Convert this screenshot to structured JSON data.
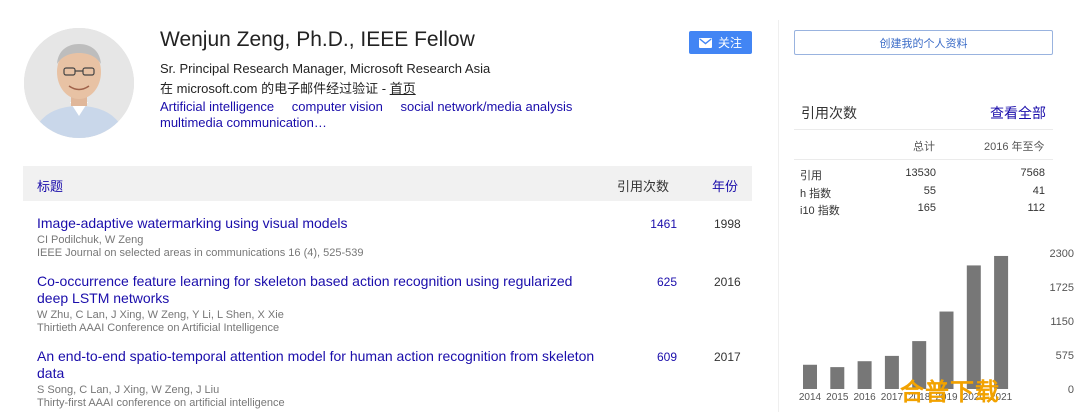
{
  "profile": {
    "name": "Wenjun Zeng, Ph.D., IEEE Fellow",
    "affiliation": "Sr. Principal Research Manager, Microsoft Research Asia",
    "verified_prefix": "在 microsoft.com 的电子邮件经过验证 - ",
    "home_link": "首页",
    "interests": [
      "Artificial intelligence",
      "computer vision",
      "social network/media analysis",
      "multimedia communication…"
    ],
    "follow_label": "关注"
  },
  "table": {
    "headers": {
      "title": "标题",
      "cited_by": "引用次数",
      "year": "年份"
    },
    "publications": [
      {
        "title": "Image-adaptive watermarking using visual models",
        "authors": "CI Podilchuk, W Zeng",
        "venue": "IEEE Journal on selected areas in communications 16 (4), 525-539",
        "cited": "1461",
        "year": "1998"
      },
      {
        "title": "Co-occurrence feature learning for skeleton based action recognition using regularized deep LSTM networks",
        "authors": "W Zhu, C Lan, J Xing, W Zeng, Y Li, L Shen, X Xie",
        "venue": "Thirtieth AAAI Conference on Artificial Intelligence",
        "cited": "625",
        "year": "2016"
      },
      {
        "title": "An end-to-end spatio-temporal attention model for human action recognition from skeleton data",
        "authors": "S Song, C Lan, J Xing, W Zeng, J Liu",
        "venue": "Thirty-first AAAI conference on artificial intelligence",
        "cited": "609",
        "year": "2017"
      }
    ]
  },
  "sidebar": {
    "create_profile": "创建我的个人资料",
    "citations_title": "引用次数",
    "view_all": "查看全部",
    "col_total": "总计",
    "col_since": "2016 年至今",
    "rows": [
      {
        "label": "引用",
        "total": "13530",
        "since": "7568"
      },
      {
        "label": "h 指数",
        "total": "55",
        "since": "41"
      },
      {
        "label": "i10 指数",
        "total": "165",
        "since": "112"
      }
    ]
  },
  "watermark": "合普下载",
  "chart_data": {
    "type": "bar",
    "categories": [
      "2014",
      "2015",
      "2016",
      "2017",
      "2018",
      "2019",
      "2020",
      "2021"
    ],
    "values": [
      410,
      370,
      470,
      560,
      810,
      1310,
      2090,
      2250
    ],
    "yticks": [
      0,
      575,
      1150,
      1725,
      2300
    ],
    "ylim": [
      0,
      2300
    ],
    "bar_color": "#777777"
  }
}
